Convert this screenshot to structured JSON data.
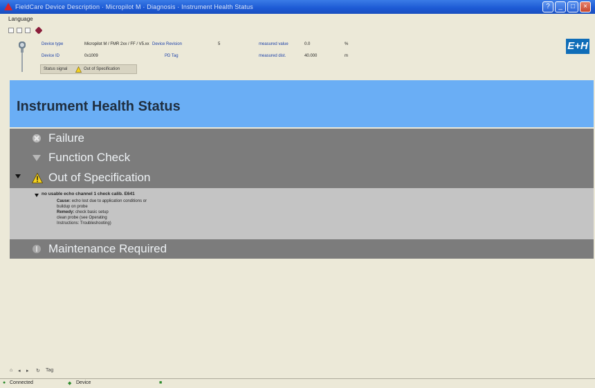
{
  "window": {
    "title": "FieldCare Device Description · Micropilot M · Diagnosis · Instrument Health Status",
    "buttons": [
      "help",
      "minimize",
      "maximize",
      "close"
    ]
  },
  "menubar": {
    "language": "Language"
  },
  "header": {
    "device_type_label": "Device type",
    "device_type_value": "Micropilot M / FMR 2xx / FF / V5.xx",
    "device_revision_label": "Device Revision",
    "device_revision_value": "5",
    "device_id_label": "Device ID",
    "device_id_value": "0x1009",
    "pd_tag_label": "PD Tag",
    "pd_tag_value": "",
    "measured_value_label": "measured value",
    "measured_value_value": "0.0",
    "measured_value_unit": "%",
    "measured_distance_label": "measured dist.",
    "measured_distance_value": "40.000",
    "measured_distance_unit": "m",
    "status_signal_label": "Status signal",
    "status_signal_value": "Out of Specification",
    "logo_text": "E+H"
  },
  "health": {
    "title": "Instrument Health Status",
    "categories": [
      {
        "label": "Failure",
        "icon": "failure-icon"
      },
      {
        "label": "Function Check",
        "icon": "function-check-icon"
      },
      {
        "label": "Out of Specification",
        "icon": "warning-triangle-icon"
      },
      {
        "label": "Maintenance Required",
        "icon": "maintenance-icon"
      }
    ],
    "detail": {
      "title": "no usable echo channel 1 check calib. E641",
      "cause_label": "Cause:",
      "cause_text": "echo lost due to application conditions or",
      "cause_text2": "buildup on probe",
      "remedy_label": "Remedy:",
      "remedy_text": "check basic setup",
      "remedy_text2": "clean probe (see Operating",
      "remedy_text3": "Instructions: Troubleshooting)"
    }
  },
  "bottom_toolbar": {
    "label": "Tag"
  },
  "statusbar": {
    "connection": "Connected",
    "mode": "Device",
    "colors": {
      "connected": "#2e8b2e"
    }
  }
}
